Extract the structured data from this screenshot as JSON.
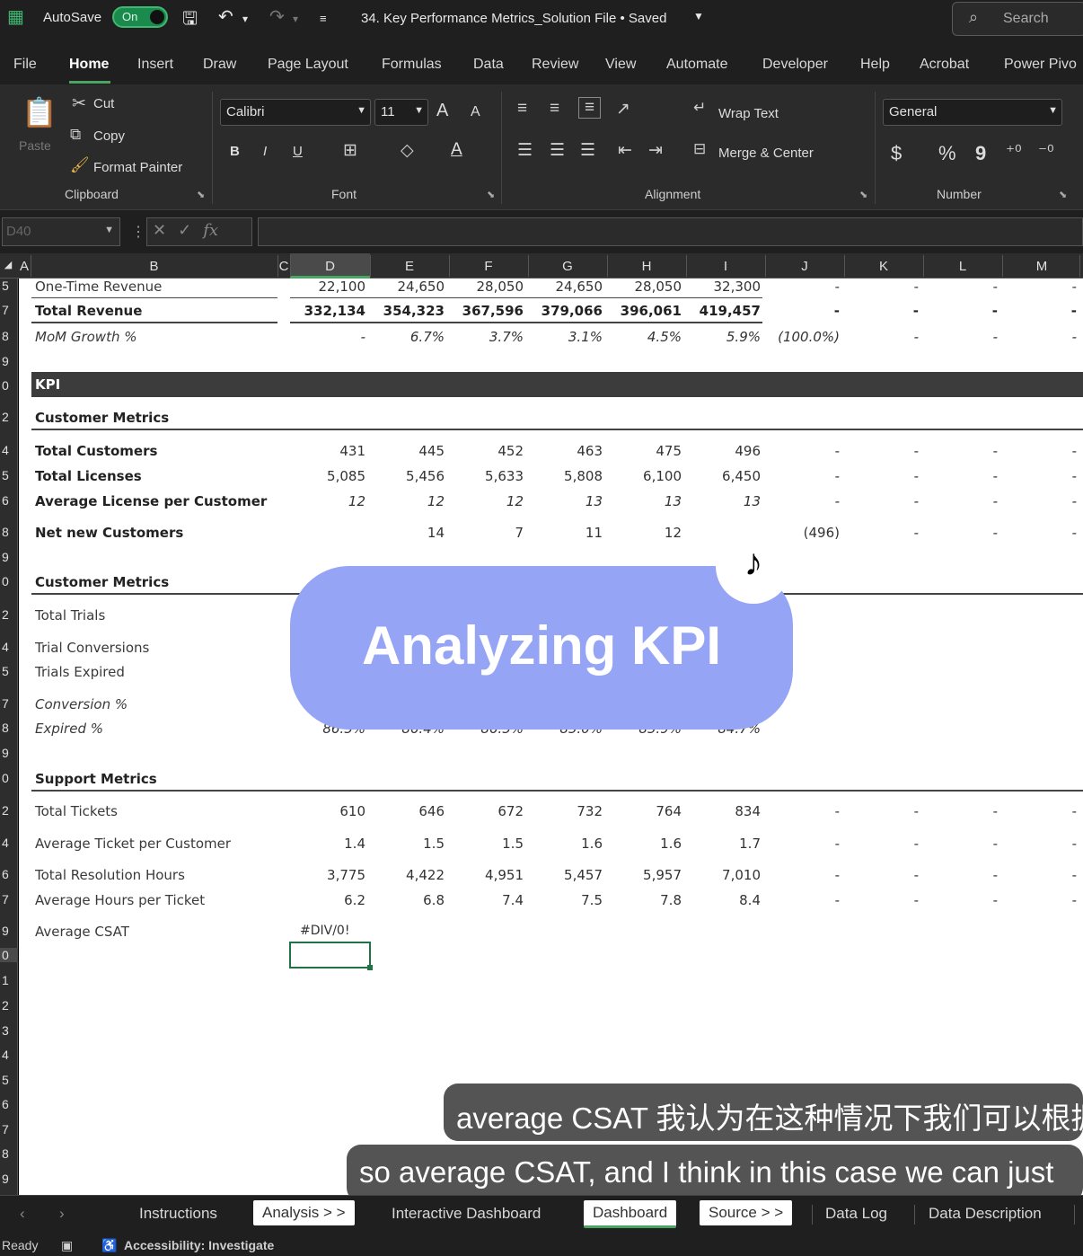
{
  "titlebar": {
    "autosave_label": "AutoSave",
    "autosave_state": "On",
    "file_title": "34. Key Performance Metrics_Solution File • Saved",
    "search_placeholder": "Search"
  },
  "menu": [
    "File",
    "Home",
    "Insert",
    "Draw",
    "Page Layout",
    "Formulas",
    "Data",
    "Review",
    "View",
    "Automate",
    "Developer",
    "Help",
    "Acrobat",
    "Power Pivo"
  ],
  "ribbon": {
    "clipboard": {
      "paste": "Paste",
      "cut": "Cut",
      "copy": "Copy",
      "format_painter": "Format Painter",
      "group": "Clipboard"
    },
    "font": {
      "name": "Calibri",
      "size": "11",
      "group": "Font",
      "bold": "B",
      "italic": "I",
      "underline": "U",
      "grow": "A",
      "shrink": "A"
    },
    "alignment": {
      "wrap": "Wrap Text",
      "merge": "Merge & Center",
      "group": "Alignment"
    },
    "number": {
      "format": "General",
      "group": "Number",
      "currency": "$",
      "percent": "%",
      "comma": "9"
    }
  },
  "formula_bar": {
    "name_box": "D40",
    "fx": "fx"
  },
  "columns": [
    "A",
    "B",
    "C",
    "D",
    "E",
    "F",
    "G",
    "H",
    "I",
    "J",
    "K",
    "L",
    "M"
  ],
  "row_numbers": [
    "5",
    "7",
    "8",
    "9",
    "0",
    "2",
    "4",
    "5",
    "6",
    "8",
    "9",
    "0",
    "2",
    "4",
    "5",
    "7",
    "8",
    "9",
    "0",
    "2",
    "4",
    "6",
    "7",
    "9",
    "0",
    "1",
    "2",
    "3",
    "4",
    "5",
    "6",
    "7",
    "8",
    "9"
  ],
  "sheet": {
    "revenue": {
      "one_time": {
        "label": "One-Time Revenue",
        "values": [
          "22,100",
          "24,650",
          "28,050",
          "24,650",
          "28,050",
          "32,300",
          "-",
          "-",
          "-",
          "-"
        ]
      },
      "total": {
        "label": "Total Revenue",
        "values": [
          "332,134",
          "354,323",
          "367,596",
          "379,066",
          "396,061",
          "419,457",
          "-",
          "-",
          "-",
          "-"
        ]
      },
      "mom": {
        "label": "MoM Growth %",
        "values": [
          "-",
          "6.7%",
          "3.7%",
          "3.1%",
          "4.5%",
          "5.9%",
          "(100.0%)",
          "-",
          "-",
          "-"
        ]
      }
    },
    "kpi_header": "KPI",
    "customer_metrics_title": "Customer Metrics",
    "customers": [
      {
        "label": "Total Customers",
        "values": [
          "431",
          "445",
          "452",
          "463",
          "475",
          "496",
          "-",
          "-",
          "-",
          "-"
        ]
      },
      {
        "label": "Total Licenses",
        "values": [
          "5,085",
          "5,456",
          "5,633",
          "5,808",
          "6,100",
          "6,450",
          "-",
          "-",
          "-",
          "-"
        ]
      },
      {
        "label": "Average License per Customer",
        "values": [
          "12",
          "12",
          "12",
          "13",
          "13",
          "13",
          "-",
          "-",
          "-",
          "-"
        ]
      },
      {
        "label": "Net new Customers",
        "values": [
          "",
          "14",
          "7",
          "11",
          "12",
          "",
          "(496)",
          "-",
          "-",
          "-"
        ]
      }
    ],
    "trial_metrics_title": "Customer Metrics",
    "trials": [
      {
        "label": "Total Trials"
      },
      {
        "label": "Trial Conversions"
      },
      {
        "label": "Trials Expired"
      },
      {
        "label": "Conversion %"
      },
      {
        "label": "Expired %",
        "values": [
          "86.5%",
          "86.4%",
          "86.5%",
          "85.0%",
          "85.9%",
          "84.7%"
        ]
      }
    ],
    "support_metrics_title": "Support Metrics",
    "support": [
      {
        "label": "Total Tickets",
        "values": [
          "610",
          "646",
          "672",
          "732",
          "764",
          "834",
          "-",
          "-",
          "-",
          "-"
        ]
      },
      {
        "label": "Average Ticket per Customer",
        "values": [
          "1.4",
          "1.5",
          "1.5",
          "1.6",
          "1.6",
          "1.7",
          "-",
          "-",
          "-",
          "-"
        ]
      },
      {
        "label": "Total Resolution Hours",
        "values": [
          "3,775",
          "4,422",
          "4,951",
          "5,457",
          "5,957",
          "7,010",
          "-",
          "-",
          "-",
          "-"
        ]
      },
      {
        "label": "Average Hours per Ticket",
        "values": [
          "6.2",
          "6.8",
          "7.4",
          "7.5",
          "7.8",
          "8.4",
          "-",
          "-",
          "-",
          "-"
        ]
      }
    ],
    "csat": {
      "label": "Average CSAT",
      "value": "#DIV/0!"
    }
  },
  "overlay": {
    "title": "Analyzing KPI",
    "logo": "♪"
  },
  "subtitles": {
    "line1": "average CSAT 我认为在这种情况下我们可以根据",
    "line2": "so average CSAT, and I think in this case we can just"
  },
  "tabs": [
    "Instructions",
    "Analysis > >",
    "Interactive Dashboard",
    "Dashboard",
    "Source > >",
    "Data Log",
    "Data Description"
  ],
  "status": {
    "ready": "Ready",
    "accessibility": "Accessibility: Investigate"
  }
}
